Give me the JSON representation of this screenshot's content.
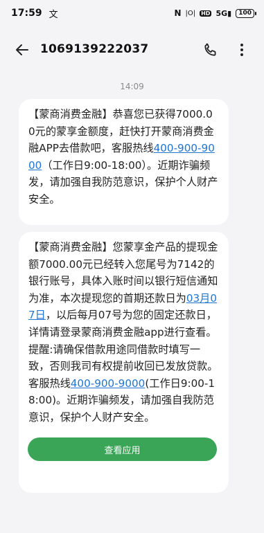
{
  "status_bar": {
    "time": "17:59",
    "notification_glyph": "文",
    "nfc": "N",
    "vibrate": "|O|",
    "hd": "HD",
    "signal": "5G",
    "battery": "100"
  },
  "header": {
    "contact_number": "1069139222037"
  },
  "conversation": {
    "timestamp": "14:09",
    "message_1": {
      "part1": "【蒙商消费金融】恭喜您已获得7000.00元的蒙享金额度，赶快打开蒙商消费金融APP去借款吧，客服热线",
      "hotline": "400-900-9000",
      "part2": "（工作日9:00-18:00）。近期诈骗频发，请加强自我防范意识，保护个人财产安全。"
    },
    "message_2": {
      "part1": "【蒙商消费金融】您蒙享金产品的提现金额7000.00元已经转入您尾号为7142的银行账号，具体入账时间以银行短信通知为准，本次提现您的首期还款日为",
      "date": "03月07日",
      "part2": "，以后每月07号为您的固定还款日，详情请登录蒙商消费金融app进行查看。提醒:请确保借款用途同借款时填写一致，否则我司有权提前收回已发放贷款。客服热线",
      "hotline": "400-900-9000",
      "part3": "(工作日9:00-18:00)。近期诈骗频发，请加强自我防范意识，保护个人财产安全。",
      "button_label": "查看应用",
      "button_color": "#3aa556"
    }
  },
  "icons": {
    "back": "arrow-left-icon",
    "call": "phone-icon",
    "more": "more-vertical-icon"
  },
  "colors": {
    "link": "#1f75d0",
    "background": "#f4f4f6",
    "bubble": "#ffffff"
  }
}
